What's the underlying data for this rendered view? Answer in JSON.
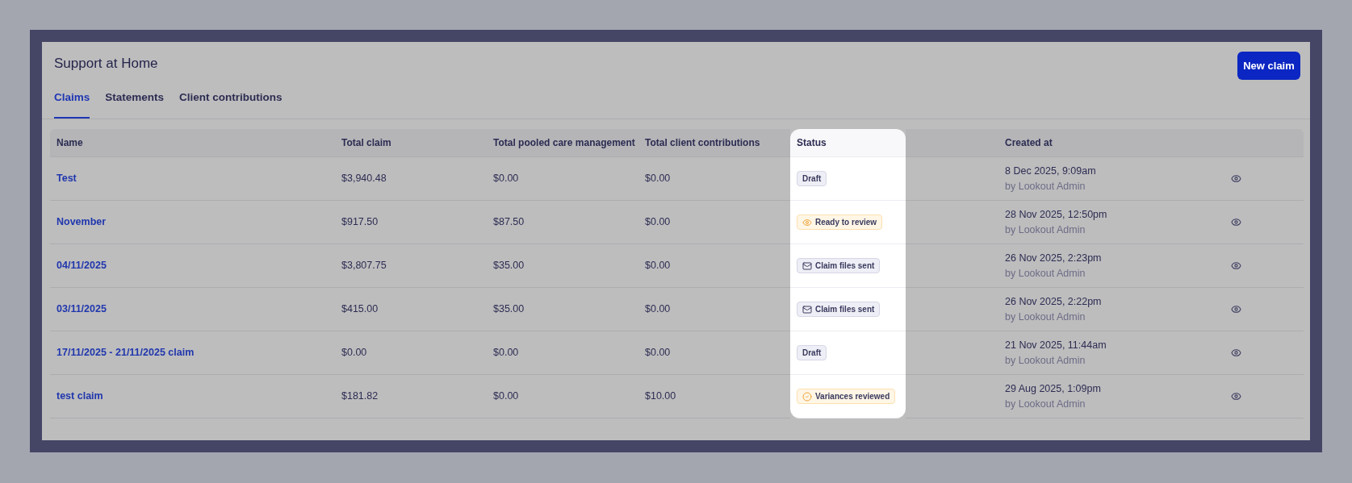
{
  "page": {
    "title": "Support at Home"
  },
  "new_claim_button": {
    "label": "New claim"
  },
  "tabs": [
    {
      "label": "Claims",
      "selected": true
    },
    {
      "label": "Statements",
      "selected": false
    },
    {
      "label": "Client contributions",
      "selected": false
    }
  ],
  "table": {
    "columns": [
      {
        "label": "Name",
        "highlighted": false
      },
      {
        "label": "Total claim",
        "highlighted": false
      },
      {
        "label": "Total pooled care management",
        "highlighted": false
      },
      {
        "label": "Total client contributions",
        "highlighted": false
      },
      {
        "label": "Status",
        "highlighted": true
      },
      {
        "label": "Created at",
        "highlighted": false
      }
    ],
    "rows": [
      {
        "name": "Test",
        "total_claim": "$3,940.48",
        "pooled": "$0.00",
        "contributions": "$0.00",
        "status": {
          "label": "Draft",
          "kind": "draft"
        },
        "created": "8 Dec 2025, 9:09am",
        "created_by": "by Lookout Admin"
      },
      {
        "name": "November",
        "total_claim": "$917.50",
        "pooled": "$87.50",
        "contributions": "$0.00",
        "status": {
          "label": "Ready to review",
          "kind": "review"
        },
        "created": "28 Nov 2025, 12:50pm",
        "created_by": "by Lookout Admin"
      },
      {
        "name": "04/11/2025",
        "total_claim": "$3,807.75",
        "pooled": "$35.00",
        "contributions": "$0.00",
        "status": {
          "label": "Claim files sent",
          "kind": "sent"
        },
        "created": "26 Nov 2025, 2:23pm",
        "created_by": "by Lookout Admin"
      },
      {
        "name": "03/11/2025",
        "total_claim": "$415.00",
        "pooled": "$35.00",
        "contributions": "$0.00",
        "status": {
          "label": "Claim files sent",
          "kind": "sent"
        },
        "created": "26 Nov 2025, 2:22pm",
        "created_by": "by Lookout Admin"
      },
      {
        "name": "17/11/2025 - 21/11/2025 claim",
        "total_claim": "$0.00",
        "pooled": "$0.00",
        "contributions": "$0.00",
        "status": {
          "label": "Draft",
          "kind": "draft"
        },
        "created": "21 Nov 2025, 11:44am",
        "created_by": "by Lookout Admin"
      },
      {
        "name": "test claim",
        "total_claim": "$181.82",
        "pooled": "$0.00",
        "contributions": "$10.00",
        "status": {
          "label": "Variances reviewed",
          "kind": "reviewed"
        },
        "created": "29 Aug 2025, 1:09pm",
        "created_by": "by Lookout Admin"
      }
    ]
  }
}
